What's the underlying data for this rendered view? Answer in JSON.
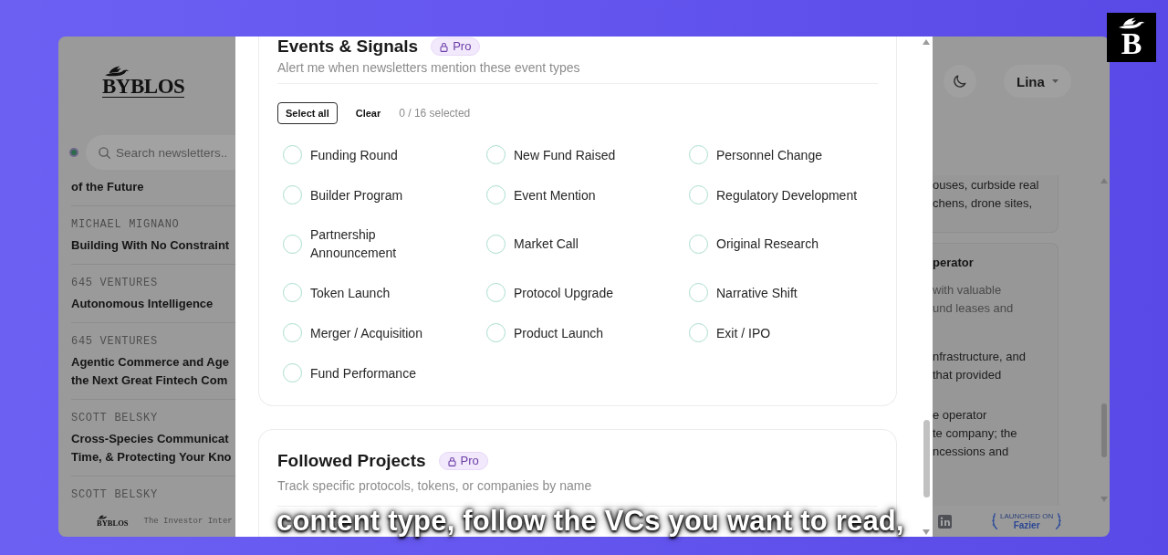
{
  "brand_badge": {
    "letter": "B"
  },
  "app": {
    "logo": "BYBLOS",
    "search": {
      "placeholder": "Search newsletters.."
    },
    "feed": [
      {
        "title": [
          "of the Future"
        ]
      },
      {
        "author": "MICHAEL MIGNANO",
        "title": [
          "Building With No Constraint"
        ]
      },
      {
        "author": "645 VENTURES",
        "title": [
          "Autonomous Intelligence"
        ]
      },
      {
        "author": "645 VENTURES",
        "title": [
          "Agentic Commerce and Age",
          "the Next Great Fintech Com"
        ]
      },
      {
        "author": "SCOTT BELSKY",
        "title": [
          "Cross-Species Communicat",
          "Time, & Protecting Your Kno"
        ]
      },
      {
        "author": "SCOTT BELSKY"
      }
    ],
    "user_menu": {
      "label": "Lina"
    },
    "cards": [
      {
        "paragraphs": [
          {
            "kind": "body",
            "lines": [
              "ouses, curbside real",
              "chens, drone sites,"
            ]
          }
        ]
      },
      {
        "heading": "perator",
        "paragraphs": [
          {
            "kind": "muted",
            "lines": [
              "with valuable",
              "und leases and"
            ]
          },
          {
            "kind": "body",
            "lines": [
              "nfrastructure, and",
              "that provided"
            ]
          },
          {
            "kind": "body",
            "lines": [
              "e operator",
              "te company; the",
              "ncessions and"
            ]
          }
        ]
      }
    ],
    "footer": {
      "logo": "BYBLOS",
      "tagline": "The Investor Inter",
      "launch_badge": {
        "caption": "LAUNCHED ON",
        "name": "Fazier"
      }
    }
  },
  "modal": {
    "sections": [
      {
        "title": "Events & Signals",
        "badge": "Pro",
        "description": "Alert me when newsletters mention these event types",
        "actions": [
          {
            "label": "Select all",
            "kind": "outlined"
          },
          {
            "label": "Clear",
            "kind": "plain"
          }
        ],
        "counter": "0 / 16 selected",
        "options": [
          {
            "label": "Funding Round",
            "checked": false
          },
          {
            "label": "New Fund Raised",
            "checked": false
          },
          {
            "label": "Personnel Change",
            "checked": false
          },
          {
            "label": "Builder Program",
            "checked": false
          },
          {
            "label": "Event Mention",
            "checked": false
          },
          {
            "label": "Regulatory Development",
            "checked": false
          },
          {
            "label": "Partnership Announcement",
            "checked": false
          },
          {
            "label": "Market Call",
            "checked": false
          },
          {
            "label": "Original Research",
            "checked": false
          },
          {
            "label": "Token Launch",
            "checked": false
          },
          {
            "label": "Protocol Upgrade",
            "checked": false
          },
          {
            "label": "Narrative Shift",
            "checked": false
          },
          {
            "label": "Merger / Acquisition",
            "checked": false
          },
          {
            "label": "Product Launch",
            "checked": false
          },
          {
            "label": "Exit / IPO",
            "checked": false
          },
          {
            "label": "Fund Performance",
            "checked": false
          }
        ]
      },
      {
        "title": "Followed Projects",
        "badge": "Pro",
        "description": "Track specific protocols, tokens, or companies by name"
      }
    ]
  },
  "caption": "content type, follow the VCs you want to read,"
}
